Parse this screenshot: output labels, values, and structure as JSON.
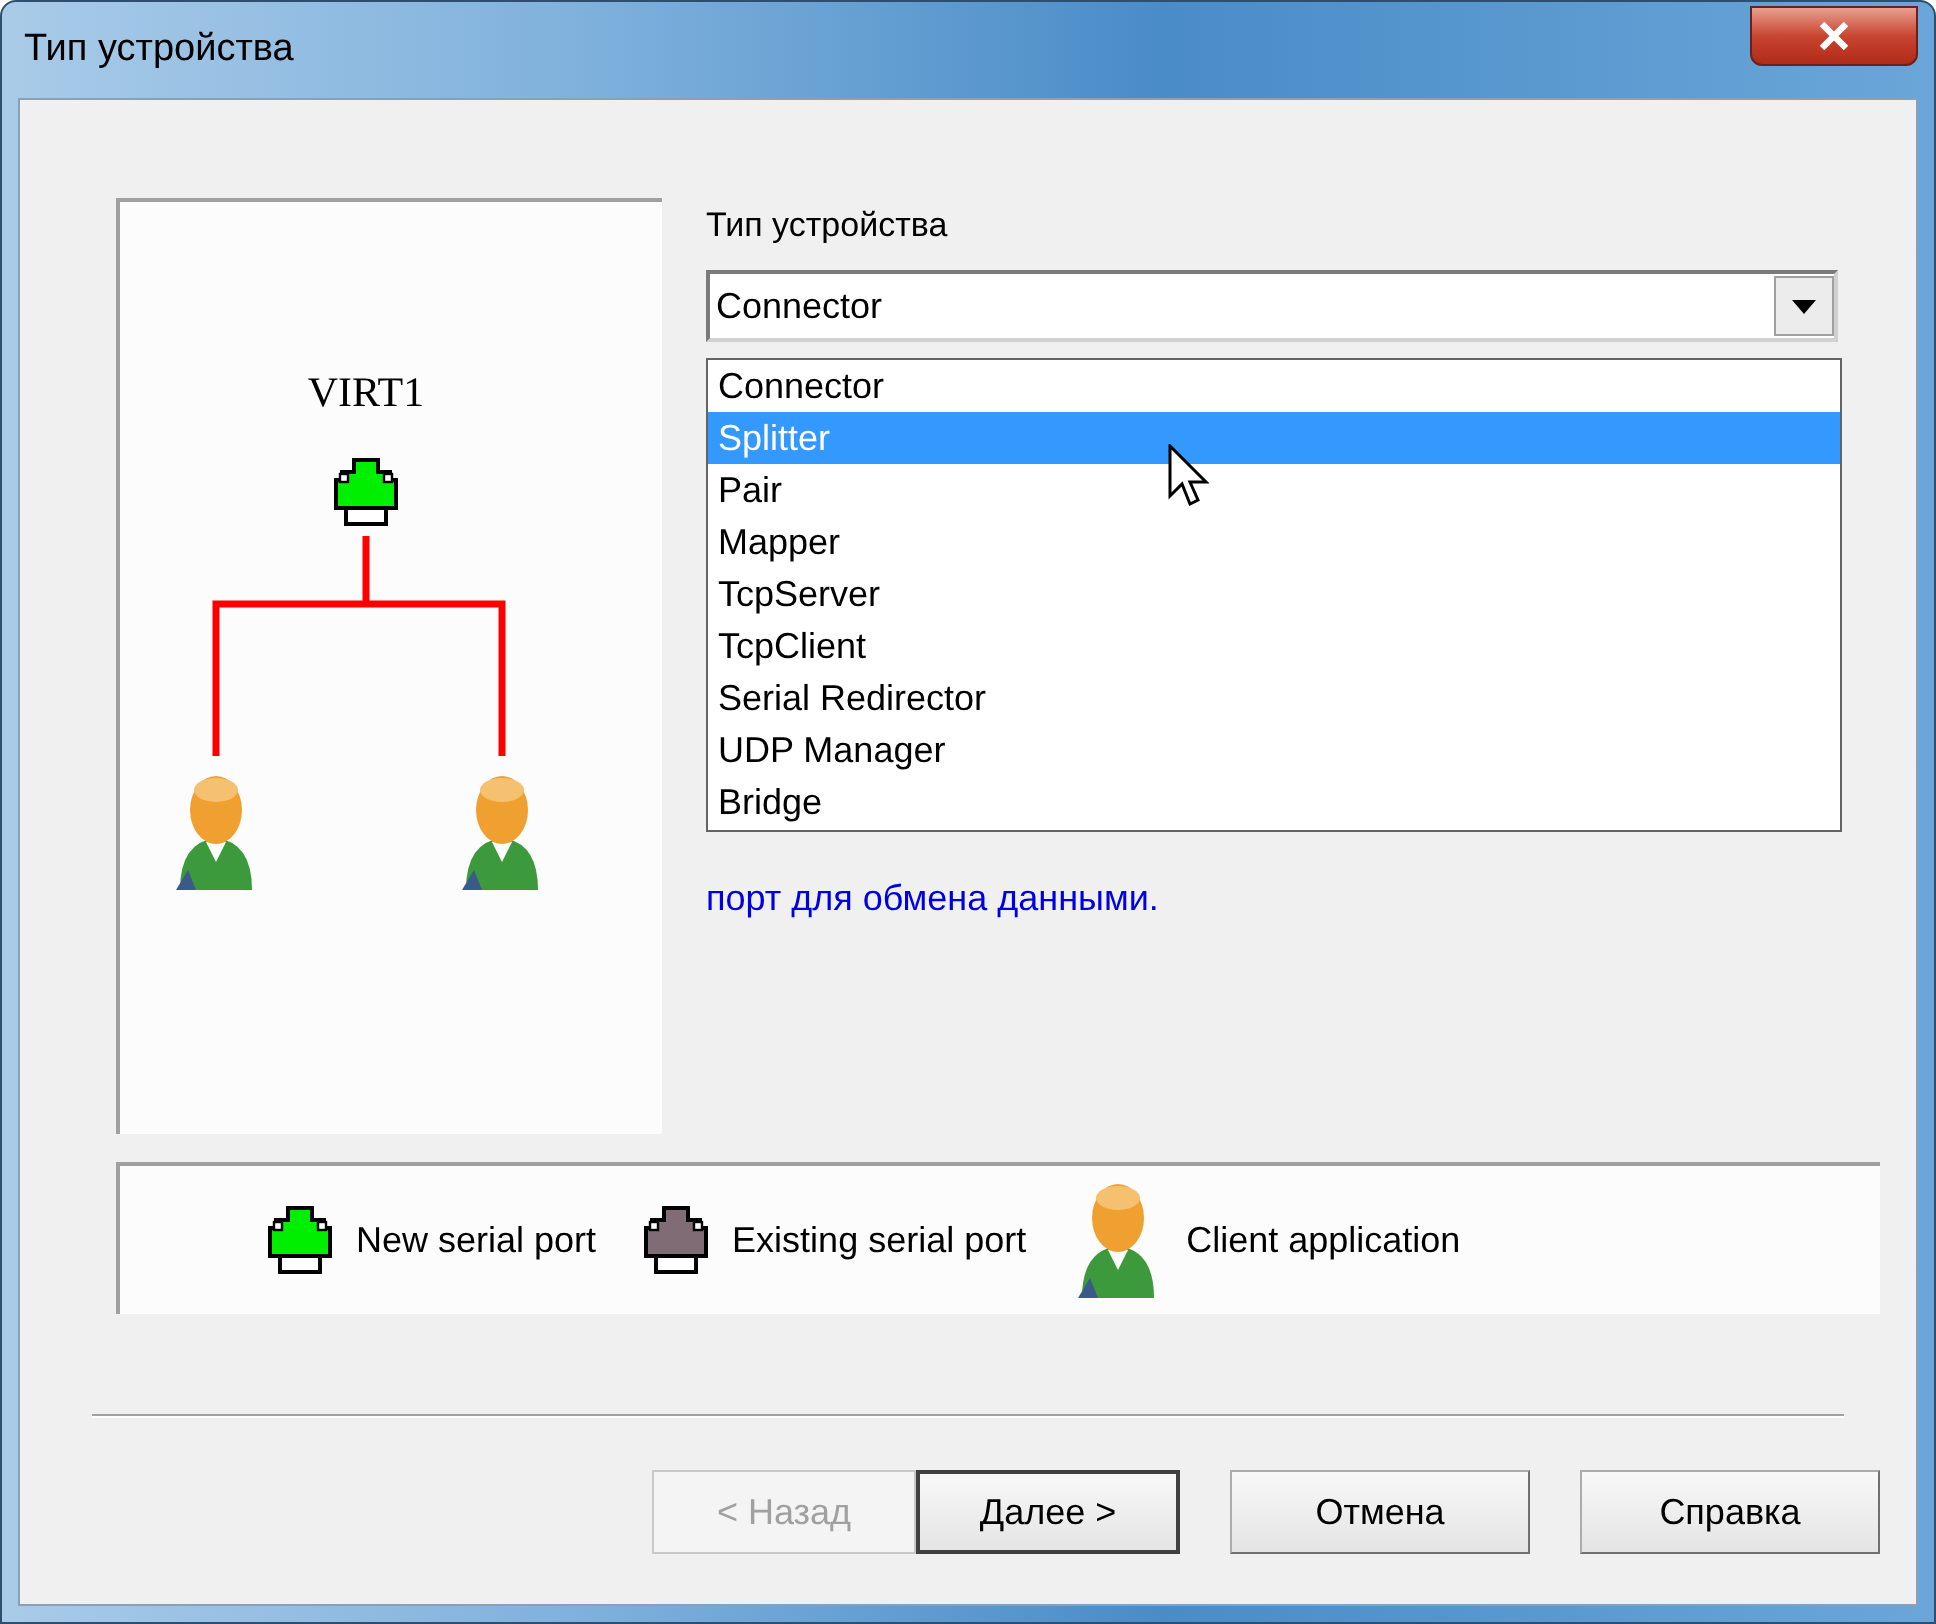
{
  "window": {
    "title": "Тип устройства"
  },
  "diagram": {
    "device_label": "VIRT1",
    "clients": [
      {
        "kind": "client"
      },
      {
        "kind": "client"
      }
    ]
  },
  "device_type": {
    "label": "Тип устройства",
    "value": "Connector",
    "expanded": true,
    "options": [
      {
        "label": "Connector",
        "highlighted": false
      },
      {
        "label": "Splitter",
        "highlighted": true
      },
      {
        "label": "Pair",
        "highlighted": false
      },
      {
        "label": "Mapper",
        "highlighted": false
      },
      {
        "label": "TcpServer",
        "highlighted": false
      },
      {
        "label": "TcpClient",
        "highlighted": false
      },
      {
        "label": "Serial Redirector",
        "highlighted": false
      },
      {
        "label": "UDP Manager",
        "highlighted": false
      },
      {
        "label": "Bridge",
        "highlighted": false
      }
    ]
  },
  "description": "порт для обмена данными.",
  "legend": [
    {
      "kind": "new_port",
      "label": "New serial port"
    },
    {
      "kind": "existing_port",
      "label": "Existing serial port"
    },
    {
      "kind": "client",
      "label": "Client application"
    }
  ],
  "buttons": [
    {
      "label": "< Назад",
      "disabled": true,
      "default": false
    },
    {
      "label": "Далее >",
      "disabled": false,
      "default": true
    },
    {
      "label": "Отмена",
      "disabled": false,
      "default": false
    },
    {
      "label": "Справка",
      "disabled": false,
      "default": false
    }
  ]
}
